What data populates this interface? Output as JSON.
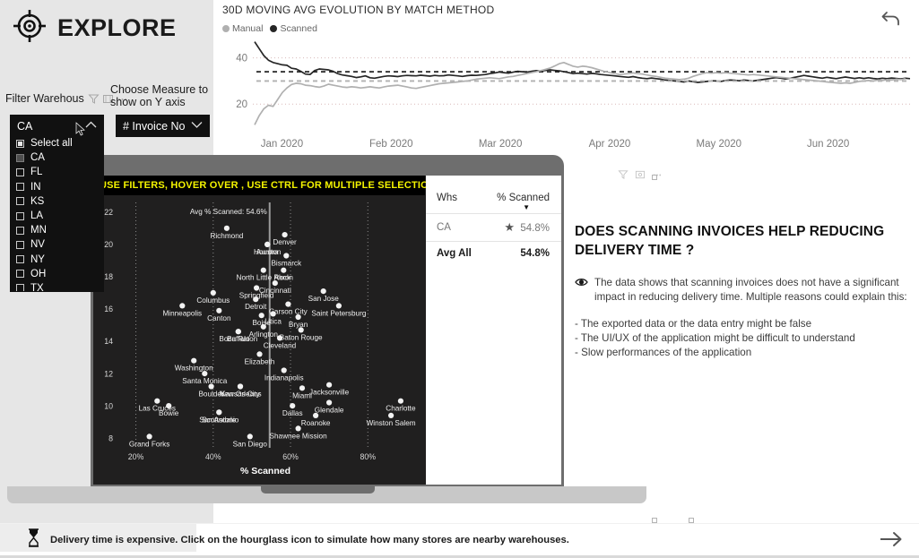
{
  "header": {
    "app_title": "EXPLORE",
    "logo_icon": "target-crosshair-icon",
    "undo_icon": "undo-arrow-icon"
  },
  "filters": {
    "warehouse_label": "Filter Warehous",
    "warehouse_icons": [
      "filter-icon",
      "focus-mode-icon",
      "more-options-icon"
    ],
    "warehouse_value": "CA",
    "measure_label": "Choose Measure to show on Y axis",
    "measure_value": "# Invoice No",
    "dropdown_items": [
      {
        "label": "Select all",
        "state": "partial"
      },
      {
        "label": "CA",
        "state": "checked"
      },
      {
        "label": "FL",
        "state": "unchecked"
      },
      {
        "label": "IN",
        "state": "unchecked"
      },
      {
        "label": "KS",
        "state": "unchecked"
      },
      {
        "label": "LA",
        "state": "unchecked"
      },
      {
        "label": "MN",
        "state": "unchecked"
      },
      {
        "label": "NV",
        "state": "unchecked"
      },
      {
        "label": "NY",
        "state": "unchecked"
      },
      {
        "label": "OH",
        "state": "unchecked"
      },
      {
        "label": "TX",
        "state": "unchecked"
      }
    ]
  },
  "line_chart": {
    "title": "30D MOVING AVG EVOLUTION BY MATCH METHOD",
    "legend": [
      {
        "label": "Manual",
        "color": "#b0b0b0"
      },
      {
        "label": "Scanned",
        "color": "#262626"
      }
    ]
  },
  "chart_data": [
    {
      "type": "line",
      "title": "30D MOVING AVG EVOLUTION BY MATCH METHOD",
      "xlabel": "",
      "ylabel": "",
      "ylim": [
        10,
        48
      ],
      "yticks": [
        20,
        40
      ],
      "xticks": [
        "Jan 2020",
        "Feb 2020",
        "Mar 2020",
        "Apr 2020",
        "May 2020",
        "Jun 2020"
      ],
      "grid": true,
      "legend_position": "top-left",
      "series": [
        {
          "name": "Scanned",
          "color": "#262626",
          "average_line": 34.0,
          "values": [
            47,
            44,
            41,
            39,
            38,
            37.5,
            37,
            36.8,
            35.5,
            35.2,
            34.2,
            33,
            32.8,
            34.5,
            35.2,
            35,
            34.8,
            34.2,
            33.2,
            32.6,
            32.3,
            32,
            31.5,
            31.8,
            32.2,
            31.4,
            31.2,
            31.6,
            32,
            32.2,
            32.1,
            31.9,
            32.2,
            32.4,
            32.3,
            32.2,
            32.5,
            32.3,
            32.1,
            32.4,
            32.2,
            32.3,
            32.6,
            32.4,
            32.2,
            32,
            32.3,
            32.5,
            32.4,
            32.6,
            32.8,
            33.2,
            33.5,
            33.9,
            33.6,
            33.4,
            33.8,
            34.2,
            34,
            33.8,
            34.2,
            34.5,
            34.3,
            34.6,
            34.8,
            34.6,
            34.4,
            34,
            33.6,
            33.2,
            33.4,
            33.2,
            33,
            33.3,
            33.1,
            32.8,
            32.6,
            32.4,
            32.2,
            32,
            31.8,
            31.6,
            31.9,
            31.5,
            31.2,
            31,
            31.3,
            31,
            30.8,
            30.4,
            30.2,
            30,
            29.8,
            29.6,
            30,
            29.7,
            29.4,
            29.6,
            29.8,
            30.1,
            30,
            29.8,
            30.2,
            30.4,
            30.3,
            30.1,
            30.4,
            30.2,
            30,
            30.3,
            30.6,
            30.9,
            31.2,
            31.5,
            31.2,
            30.9,
            31.2,
            31.6,
            32,
            32.4,
            32.1,
            31.8,
            31.5,
            31.2,
            31.6,
            31.3,
            31,
            31.4,
            31.7,
            31.4,
            31.1,
            31.4,
            31.1,
            31.4,
            31.1,
            30.9,
            31.2,
            31,
            31.3,
            31.1,
            30.9,
            31.2,
            31
          ]
        },
        {
          "name": "Manual",
          "color": "#b0b0b0",
          "average_line": 30.0,
          "values": [
            11,
            15,
            18,
            19.5,
            19,
            22,
            25,
            27,
            28.5,
            29,
            28.8,
            28.2,
            28,
            27.6,
            27.3,
            27.8,
            28.6,
            28.2,
            27.8,
            27.4,
            27.2,
            27.5,
            27.3,
            27,
            27.2,
            27.5,
            27.2,
            27,
            27.4,
            27.8,
            28,
            28.2,
            27.8,
            27.4,
            27,
            26.8,
            27.2,
            27.6,
            28,
            28.4,
            28.8,
            29,
            29.2,
            29.4,
            29.6,
            29.8,
            30,
            30.4,
            30.8,
            31,
            31.2,
            31.4,
            31.2,
            31,
            31.4,
            31.8,
            32,
            32.4,
            32.8,
            33.2,
            33.6,
            34,
            34.5,
            35,
            35.6,
            36.5,
            37.5,
            38,
            37.2,
            36.4,
            36,
            36.4,
            36.2,
            35.8,
            35.2,
            34.6,
            34,
            33.6,
            33.2,
            32.8,
            33,
            33.2,
            33.5,
            33.2,
            33,
            32.6,
            32.2,
            32,
            31.6,
            31.2,
            31,
            30.8,
            30.6,
            30.8,
            31.2,
            32,
            32.6,
            33.2,
            33.6,
            33.4,
            33.6,
            33.4,
            33.6,
            33.4,
            33.2,
            33,
            32.8,
            32.6,
            32.8,
            32.6,
            32.4,
            32.2,
            32,
            31.8,
            31.6,
            31.4,
            31.2,
            31,
            30.8,
            30.6,
            30.4,
            30.2,
            30,
            29.8,
            29.6,
            29.4,
            29.2,
            29,
            29.2,
            29,
            29.4,
            29.8,
            30,
            30.2,
            30,
            30.4,
            30.2,
            30.6,
            30.4,
            30.8,
            30.6,
            31
          ]
        }
      ]
    },
    {
      "type": "scatter",
      "title": "USE FILTERS, HOVER OVER , USE CTRL FOR MULTIPLE SELECTION",
      "xlabel": "% Scanned",
      "ylabel": "",
      "annotation": "Avg % Scanned: 54.6%",
      "avg_x": 54.6,
      "xticks": [
        "20%",
        "40%",
        "60%",
        "80%"
      ],
      "xlim": [
        15,
        92
      ],
      "ylim": [
        7.4,
        22.6
      ],
      "yticks": [
        8,
        10,
        12,
        14,
        16,
        18,
        20,
        22
      ],
      "grid": true,
      "points": [
        {
          "label": "Richmond",
          "x": 43.5,
          "y": 21.0
        },
        {
          "label": "Houston",
          "x": 54.0,
          "y": 20.0
        },
        {
          "label": "Denver",
          "x": 58.5,
          "y": 20.6
        },
        {
          "label": "Aurora",
          "x": 54.0,
          "y": 20.0
        },
        {
          "label": "Bismarck",
          "x": 58.9,
          "y": 19.3
        },
        {
          "label": "North Little Rock",
          "x": 53.0,
          "y": 18.4
        },
        {
          "label": "Akron",
          "x": 58.2,
          "y": 18.4
        },
        {
          "label": "Springfield",
          "x": 51.2,
          "y": 17.3
        },
        {
          "label": "Cincinnati",
          "x": 56.0,
          "y": 17.6
        },
        {
          "label": "San Jose",
          "x": 68.5,
          "y": 17.1
        },
        {
          "label": "Columbus",
          "x": 40.0,
          "y": 17.0
        },
        {
          "label": "Detroit",
          "x": 51.0,
          "y": 16.6
        },
        {
          "label": "Carson City",
          "x": 59.4,
          "y": 16.3
        },
        {
          "label": "Saint Petersburg",
          "x": 72.5,
          "y": 16.2
        },
        {
          "label": "Minneapolis",
          "x": 32.0,
          "y": 16.2
        },
        {
          "label": "Canton",
          "x": 41.5,
          "y": 15.9
        },
        {
          "label": "Boise",
          "x": 52.5,
          "y": 15.6
        },
        {
          "label": "Utica",
          "x": 55.5,
          "y": 15.7
        },
        {
          "label": "Bryan",
          "x": 62.0,
          "y": 15.5
        },
        {
          "label": "Buffalo",
          "x": 46.5,
          "y": 14.6
        },
        {
          "label": "Arlington",
          "x": 53.0,
          "y": 14.9
        },
        {
          "label": "Baton Rouge",
          "x": 62.7,
          "y": 14.7
        },
        {
          "label": "Boca Raton",
          "x": 46.5,
          "y": 14.6
        },
        {
          "label": "Cleveland",
          "x": 57.2,
          "y": 14.2
        },
        {
          "label": "Elizabeth",
          "x": 52.0,
          "y": 13.2
        },
        {
          "label": "Washington",
          "x": 35.0,
          "y": 12.8
        },
        {
          "label": "Santa Monica",
          "x": 37.8,
          "y": 12.0
        },
        {
          "label": "Indianapolis",
          "x": 58.3,
          "y": 12.2
        },
        {
          "label": "New Orleans",
          "x": 47.0,
          "y": 11.2
        },
        {
          "label": "Jacksonville",
          "x": 70.0,
          "y": 11.3
        },
        {
          "label": "Miami",
          "x": 63.0,
          "y": 11.1
        },
        {
          "label": "Boulder",
          "x": 39.5,
          "y": 11.2
        },
        {
          "label": "Kansas City",
          "x": 47.0,
          "y": 11.2
        },
        {
          "label": "Las Cruces",
          "x": 25.5,
          "y": 10.3
        },
        {
          "label": "Glendale",
          "x": 70.0,
          "y": 10.2
        },
        {
          "label": "Charlotte",
          "x": 88.5,
          "y": 10.3
        },
        {
          "label": "Bowie",
          "x": 28.5,
          "y": 10.0
        },
        {
          "label": "Scottsdale",
          "x": 41.5,
          "y": 9.6
        },
        {
          "label": "Dallas",
          "x": 60.5,
          "y": 10.0
        },
        {
          "label": "Roanoke",
          "x": 66.5,
          "y": 9.4
        },
        {
          "label": "Winston Salem",
          "x": 86.0,
          "y": 9.4
        },
        {
          "label": "San Antonio",
          "x": 41.5,
          "y": 9.6
        },
        {
          "label": "San Diego",
          "x": 49.5,
          "y": 8.1
        },
        {
          "label": "Shawnee Mission",
          "x": 62.0,
          "y": 8.6
        },
        {
          "label": "Grand Forks",
          "x": 23.5,
          "y": 8.1
        }
      ]
    }
  ],
  "table": {
    "columns": [
      "Whs",
      "% Scanned"
    ],
    "sort_indicator": "sort-descending-caret",
    "rows": [
      {
        "whs": "CA",
        "badge": "star-icon",
        "value": "54.8%"
      }
    ],
    "total": {
      "label": "Avg All",
      "value": "54.8%"
    }
  },
  "visual_icons": [
    "filter-icon",
    "focus-mode-icon",
    "more-options-icon"
  ],
  "insight": {
    "title": "DOES SCANNING INVOICES HELP REDUCING DELIVERY TIME ?",
    "icon": "eye-icon",
    "paragraph": "The data shows that scanning invoices does not have a significant impact in reducing delivery time. Multiple reasons could explain this:",
    "bullets": [
      "- The exported data or the data entry might be false",
      "- The UI/UX of the application might be difficult to understand",
      "- Slow performances of the application"
    ]
  },
  "footer": {
    "icon": "hourglass-icon",
    "text": "Delivery time is expensive. Click on the hourglass icon to simulate how many stores are nearby warehouses.",
    "next_icon": "right-arrow-icon"
  }
}
